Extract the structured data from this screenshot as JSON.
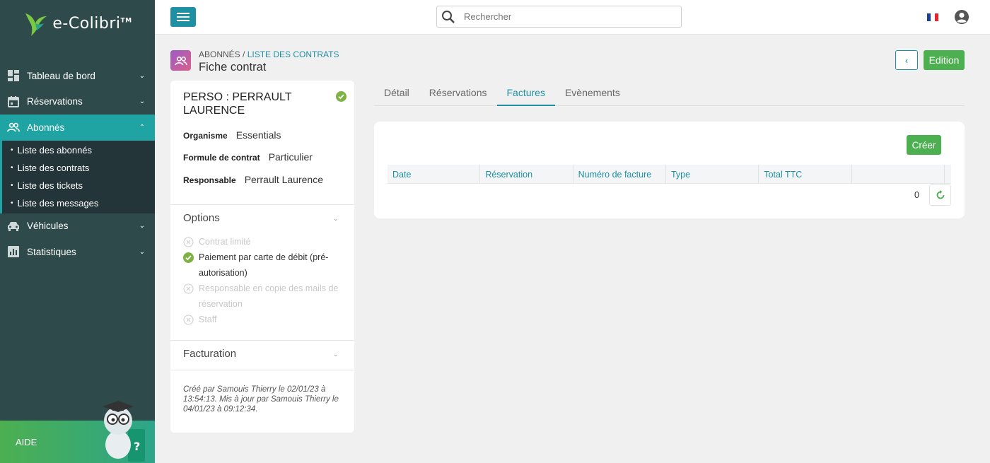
{
  "app": {
    "logo_text": "e-Colibri",
    "logo_tm": "TM"
  },
  "sidebar": {
    "items": [
      {
        "label": "Tableau de bord",
        "icon": "dashboard-icon"
      },
      {
        "label": "Réservations",
        "icon": "calendar-icon"
      },
      {
        "label": "Abonnés",
        "icon": "users-icon",
        "active": true
      },
      {
        "label": "Véhicules",
        "icon": "car-icon"
      },
      {
        "label": "Statistiques",
        "icon": "chart-icon"
      }
    ],
    "subitems": [
      "Liste des abonnés",
      "Liste des contrats",
      "Liste des tickets",
      "Liste des messages"
    ],
    "help_label": "AIDE"
  },
  "topbar": {
    "search_placeholder": "Rechercher",
    "language": "fr"
  },
  "header": {
    "breadcrumb_root": "ABONNÉS",
    "breadcrumb_sep": " / ",
    "breadcrumb_link": "LISTE DES CONTRATS",
    "title": "Fiche contrat",
    "back_label": "‹",
    "edit_label": "Edition"
  },
  "contract": {
    "name": "PERSO : PERRAULT LAURENCE",
    "fields": [
      {
        "key": "Organisme",
        "value": "Essentials"
      },
      {
        "key": "Formule de contrat",
        "value": "Particulier"
      },
      {
        "key": "Responsable",
        "value": "Perrault Laurence"
      }
    ],
    "options_title": "Options",
    "options": [
      {
        "label": "Contrat limité",
        "enabled": false
      },
      {
        "label": "Paiement par carte de débit (pré-autorisation)",
        "enabled": true
      },
      {
        "label": "Responsable en copie des mails de réservation",
        "enabled": false
      },
      {
        "label": "Staff",
        "enabled": false
      }
    ],
    "billing_title": "Facturation",
    "footnote": "Créé par Samouis Thierry le 02/01/23 à 13:54:13. Mis à jour par Samouis Thierry le 04/01/23 à 09:12:34."
  },
  "tabs": [
    {
      "label": "Détail"
    },
    {
      "label": "Réservations"
    },
    {
      "label": "Factures",
      "active": true
    },
    {
      "label": "Evènements"
    }
  ],
  "invoices": {
    "create_label": "Créer",
    "columns": [
      "Date",
      "Réservation",
      "Numéro de facture",
      "Type",
      "Total TTC"
    ],
    "count": "0"
  },
  "colors": {
    "accent": "#1f8fa3",
    "green": "#4caf50",
    "sidebar": "#2e4a4a",
    "active_nav": "#1fa3a3"
  }
}
